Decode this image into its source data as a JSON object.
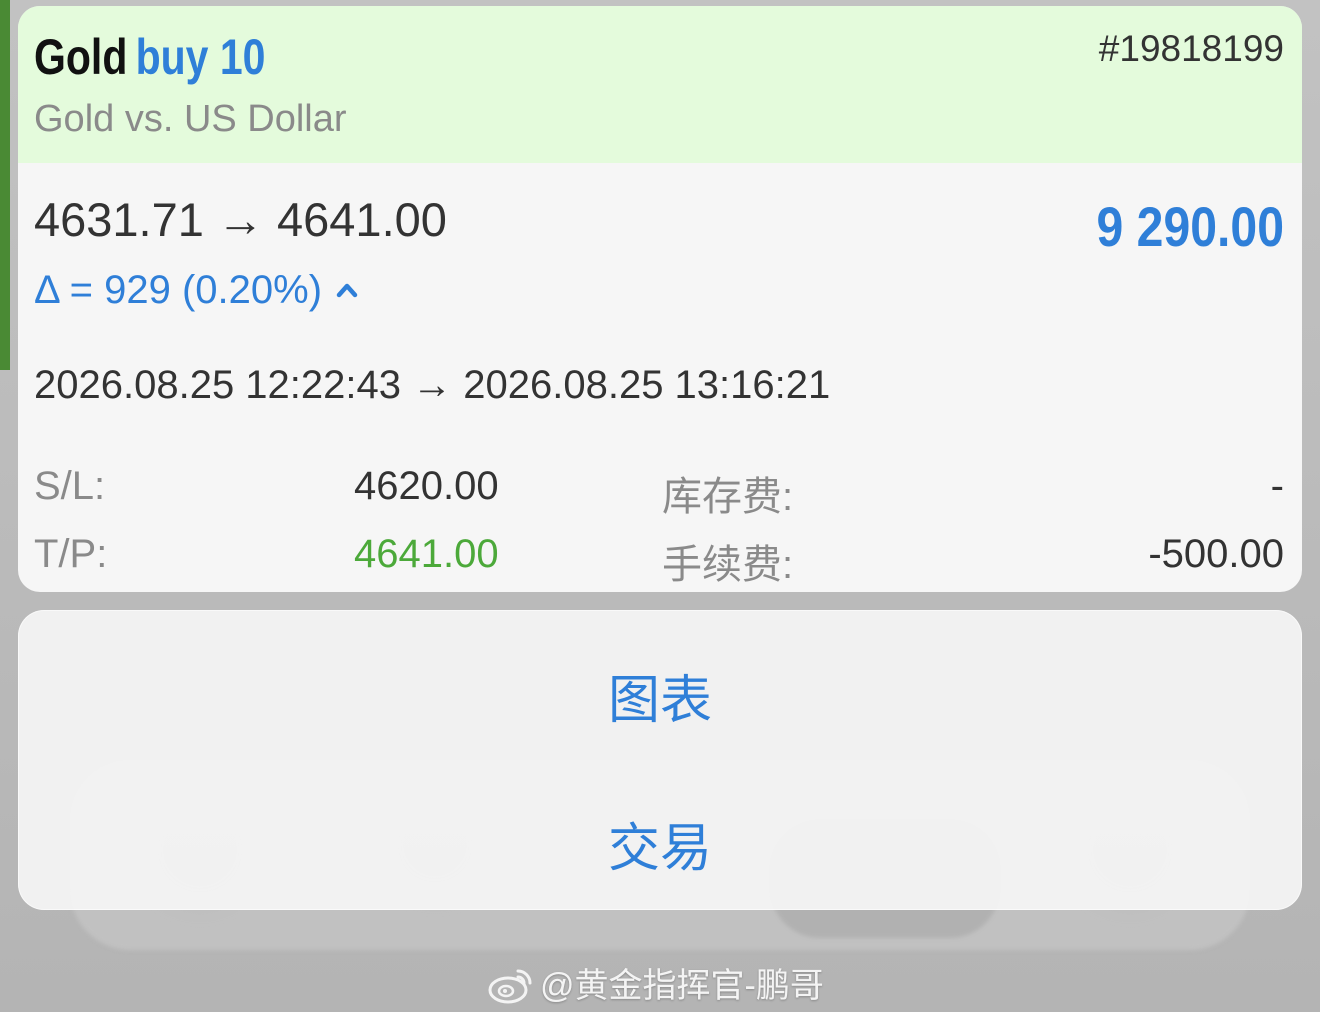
{
  "position": {
    "symbol": "Gold",
    "side_volume": "buy 10",
    "description": "Gold vs. US Dollar",
    "ticket": "#19818199",
    "price_range": "4631.71 → 4641.00",
    "profit": "9 290.00",
    "delta": "Δ = 929 (0.20%)",
    "time_range": "2026.08.25 12:22:43 → 2026.08.25 13:16:21",
    "sl_label": "S/L:",
    "sl_value": "4620.00",
    "tp_label": "T/P:",
    "tp_value": "4641.00",
    "swap_label": "库存费:",
    "swap_value": "-",
    "commission_label": "手续费:",
    "commission_value": "-500.00"
  },
  "actions": {
    "chart": "图表",
    "trade": "交易"
  },
  "watermark": {
    "text": "@黄金指挥官-鹏哥",
    "icon": "weibo-icon"
  },
  "colors": {
    "accent_blue": "#2f7fd8",
    "header_green_bg": "#e4fbdc",
    "tp_green": "#4ca93a"
  }
}
